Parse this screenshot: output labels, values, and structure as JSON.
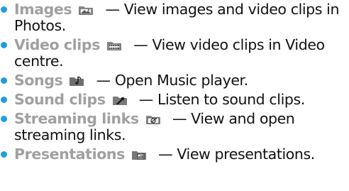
{
  "colors": {
    "bullet": "#1f9de0",
    "term": "#a0a0a0",
    "text": "#111111"
  },
  "items": [
    {
      "term": "Images",
      "icon": "images-folder-icon",
      "dash": "—",
      "description": "View images and video clips in Photos."
    },
    {
      "term": "Video clips",
      "icon": "video-clips-folder-icon",
      "dash": "—",
      "description": "View video clips in Video centre."
    },
    {
      "term": "Songs",
      "icon": "songs-folder-icon",
      "dash": "—",
      "description": "Open Music player."
    },
    {
      "term": "Sound clips",
      "icon": "sound-clips-folder-icon",
      "dash": "—",
      "description": "Listen to sound clips."
    },
    {
      "term": "Streaming links",
      "icon": "streaming-links-folder-icon",
      "dash": "—",
      "description": "View and open streaming links."
    },
    {
      "term": "Presentations",
      "icon": "presentations-folder-icon",
      "dash": "—",
      "description": "View presentations."
    }
  ]
}
